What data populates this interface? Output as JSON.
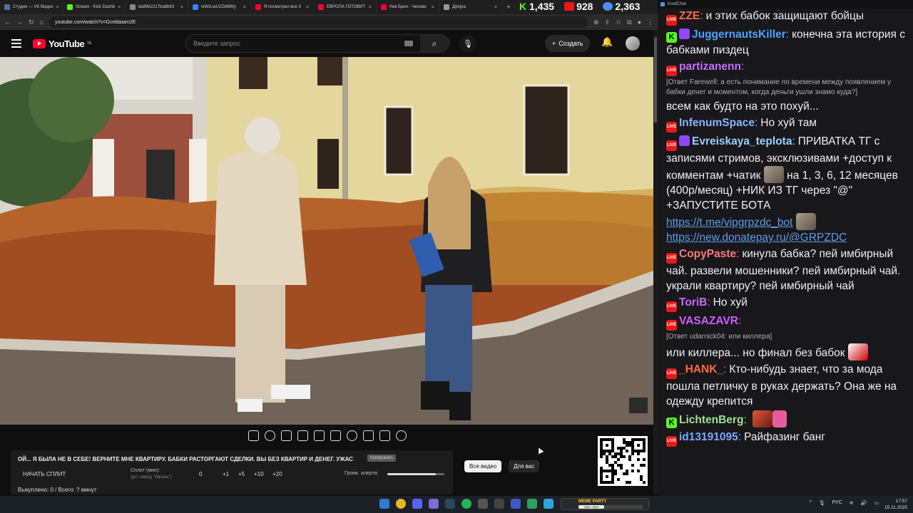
{
  "browser": {
    "tabs": [
      {
        "label": "Студия — VK Видео",
        "color": "#4a76a8"
      },
      {
        "label": "Stream - Kick Dashb",
        "color": "#53fc18"
      },
      {
        "label": "da99b2217ba6b63",
        "color": "#888888"
      },
      {
        "label": "viWzLwU2ZdMWy",
        "color": "#3b82f6"
      },
      {
        "label": "Я посмотрел все Х",
        "color": "#ff0033"
      },
      {
        "label": "ЕВРОПА ГОТОВИТ",
        "color": "#ff0033"
      },
      {
        "label": "Ник Брин - Челове",
        "color": "#ff0033"
      },
      {
        "label": "Д(м)ра",
        "color": "#999999"
      }
    ],
    "url": "youtube.com/watch?v=Dceldaiam2E"
  },
  "viewer_counts": {
    "kick": "1,435",
    "live": "928",
    "people": "2,363"
  },
  "youtube": {
    "logo": "YouTube",
    "region": "NL",
    "search_placeholder": "Введите запрос",
    "create_label": "Создать"
  },
  "panel": {
    "title": "ОЙ... Я БЫЛА НЕ В СЕБЕ! ВЕРНИТЕ МНЕ КВАРТИРУ. БАБКИ РАСТОРГАЮТ СДЕЛКИ. ВЫ БЕЗ КВАРТИР И ДЕНЕГ. УЖАС",
    "copy_label": "Копировать",
    "split_button": "НАЧАТЬ СПЛИТ",
    "split_label": "Сплит (мин):",
    "split_hint": "(уст. перед \"Начать\")",
    "split_values": [
      "0",
      "+1",
      "+5",
      "+10",
      "+20"
    ],
    "alert_label": "Громк. алерта:",
    "alert_volume": 0.85,
    "total": "Выкуплено: 0 / Всего: ? минут"
  },
  "filters": {
    "all": "Все видео",
    "for_you": "Для вас"
  },
  "chat": {
    "title": "KoellChat",
    "messages": [
      {
        "badges": [
          "live"
        ],
        "nick": "ZZE",
        "color": "#ff6b3d",
        "text": "и этих бабок защищают бойцы"
      },
      {
        "badges": [
          "kick",
          "emoji"
        ],
        "nick": "JuggernautsKiller",
        "color": "#4aa3ff",
        "text": "конечна эта история с бабками пиздец"
      },
      {
        "badges": [
          "live"
        ],
        "nick": "partizanenn",
        "color": "#c86cff",
        "reply": "[Ответ Farewell: а есть понимание по времени между появлением у бабки денег и моментом, когда деньги ушли знамо куда?]",
        "text": "всем как будто на это похуй..."
      },
      {
        "badges": [
          "live"
        ],
        "nick": "InfenumSpace",
        "color": "#8bb4ff",
        "text": "Но хуй там"
      },
      {
        "badges": [
          "live",
          "emoji"
        ],
        "nick": "Evreiskaya_teplota",
        "color": "#9ad0ff",
        "text_a": "ПРИВАТКА ТГ с записями стримов, эксклюзивами +доступ к комментам +чатик",
        "text_b": "на 1, 3, 6, 12 месяцев (400р/месяц) +НИК ИЗ ТГ через \"@\" +ЗАПУСТИТЕ БОТА",
        "link1": "https://t.me/vipgrpzdc_bot",
        "link2": "https://new.donatepay.ru/@GRPZDC"
      },
      {
        "badges": [
          "live"
        ],
        "nick": "CopyPaste",
        "color": "#ff7a7a",
        "text": "кинула бабка? пей имбирный чай. развели мошенники? пей имбирный чай. украли квартиру? пей имбирный чай"
      },
      {
        "badges": [
          "live"
        ],
        "nick": "ToriB",
        "color": "#c86cff",
        "text": "Но хуй"
      },
      {
        "badges": [
          "live"
        ],
        "nick": "VASAZAVR",
        "color": "#d35cff",
        "reply": "[Ответ udarnick04: или киллера]",
        "text": "или киллера... но финал без бабок"
      },
      {
        "badges": [
          "live"
        ],
        "nick": "_HANK_",
        "color": "#ff6b3d",
        "text": "Кто-нибудь знает, что за мода пошла петличку в руках держать? Она же на одежду крепится"
      },
      {
        "badges": [
          "kick"
        ],
        "nick": "LichtenBerg",
        "color": "#9be38b",
        "text": ""
      },
      {
        "badges": [
          "live"
        ],
        "nick": "id13191095",
        "color": "#7aa8ff",
        "text": "Райфазинг банг"
      }
    ]
  },
  "taskbar": {
    "badge_title": "MEME PARTY",
    "badge_progress": "1850 / 5000",
    "lang": "РУС",
    "time": "17:57",
    "date": "15.11.2025"
  }
}
